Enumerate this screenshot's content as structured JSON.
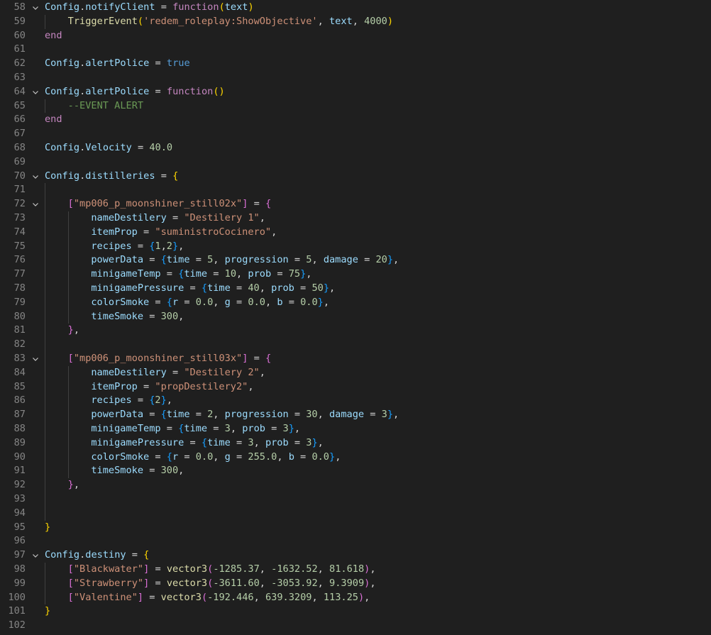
{
  "colors": {
    "background": "#1f1f1f",
    "line_number": "#858585",
    "default": "#d4d4d4",
    "variable": "#9cdcfe",
    "keyword": "#c586c0",
    "function": "#dcdcaa",
    "string": "#ce9178",
    "number": "#b5cea8",
    "constant": "#569cd6",
    "comment": "#6a9955",
    "bracket1": "#ffd700",
    "bracket2": "#da70d6",
    "bracket3": "#179fff"
  },
  "lines": [
    {
      "n": "58",
      "fold": true,
      "indent": 0,
      "tokens": [
        [
          "Config",
          "v"
        ],
        [
          ".",
          "d"
        ],
        [
          "notifyClient",
          "v"
        ],
        [
          " = ",
          "d"
        ],
        [
          "function",
          "k"
        ],
        [
          "(",
          "b1"
        ],
        [
          "text",
          "v"
        ],
        [
          ")",
          "b1"
        ]
      ]
    },
    {
      "n": "59",
      "fold": false,
      "indent": 1,
      "tokens": [
        [
          "TriggerEvent",
          "f"
        ],
        [
          "(",
          "b1"
        ],
        [
          "'redem_roleplay:ShowObjective'",
          "s"
        ],
        [
          ", ",
          "d"
        ],
        [
          "text",
          "v"
        ],
        [
          ", ",
          "d"
        ],
        [
          "4000",
          "n"
        ],
        [
          ")",
          "b1"
        ]
      ]
    },
    {
      "n": "60",
      "fold": false,
      "indent": 0,
      "tokens": [
        [
          "end",
          "k"
        ]
      ]
    },
    {
      "n": "61",
      "fold": false,
      "indent": 0,
      "tokens": []
    },
    {
      "n": "62",
      "fold": false,
      "indent": 0,
      "tokens": [
        [
          "Config",
          "v"
        ],
        [
          ".",
          "d"
        ],
        [
          "alertPolice",
          "v"
        ],
        [
          " = ",
          "d"
        ],
        [
          "true",
          "c"
        ]
      ]
    },
    {
      "n": "63",
      "fold": false,
      "indent": 0,
      "tokens": []
    },
    {
      "n": "64",
      "fold": true,
      "indent": 0,
      "tokens": [
        [
          "Config",
          "v"
        ],
        [
          ".",
          "d"
        ],
        [
          "alertPolice",
          "v"
        ],
        [
          " = ",
          "d"
        ],
        [
          "function",
          "k"
        ],
        [
          "()",
          "b1"
        ]
      ]
    },
    {
      "n": "65",
      "fold": false,
      "indent": 1,
      "tokens": [
        [
          "--EVENT ALERT",
          "cm"
        ]
      ]
    },
    {
      "n": "66",
      "fold": false,
      "indent": 0,
      "tokens": [
        [
          "end",
          "k"
        ]
      ]
    },
    {
      "n": "67",
      "fold": false,
      "indent": 0,
      "tokens": []
    },
    {
      "n": "68",
      "fold": false,
      "indent": 0,
      "tokens": [
        [
          "Config",
          "v"
        ],
        [
          ".",
          "d"
        ],
        [
          "Velocity",
          "v"
        ],
        [
          " = ",
          "d"
        ],
        [
          "40.0",
          "n"
        ]
      ]
    },
    {
      "n": "69",
      "fold": false,
      "indent": 0,
      "tokens": []
    },
    {
      "n": "70",
      "fold": true,
      "indent": 0,
      "tokens": [
        [
          "Config",
          "v"
        ],
        [
          ".",
          "d"
        ],
        [
          "distilleries",
          "v"
        ],
        [
          " = ",
          "d"
        ],
        [
          "{",
          "b1"
        ]
      ]
    },
    {
      "n": "71",
      "fold": false,
      "indent": 0,
      "tokens": []
    },
    {
      "n": "72",
      "fold": true,
      "indent": 1,
      "tokens": [
        [
          "[",
          "b2"
        ],
        [
          "\"mp006_p_moonshiner_still02x\"",
          "s"
        ],
        [
          "]",
          "b2"
        ],
        [
          " = ",
          "d"
        ],
        [
          "{",
          "b2"
        ]
      ]
    },
    {
      "n": "73",
      "fold": false,
      "indent": 2,
      "tokens": [
        [
          "nameDestilery",
          "v"
        ],
        [
          " = ",
          "d"
        ],
        [
          "\"Destilery 1\"",
          "s"
        ],
        [
          ",",
          "d"
        ]
      ]
    },
    {
      "n": "74",
      "fold": false,
      "indent": 2,
      "tokens": [
        [
          "itemProp",
          "v"
        ],
        [
          " = ",
          "d"
        ],
        [
          "\"suministroCocinero\"",
          "s"
        ],
        [
          ",",
          "d"
        ]
      ]
    },
    {
      "n": "75",
      "fold": false,
      "indent": 2,
      "tokens": [
        [
          "recipes",
          "v"
        ],
        [
          " = ",
          "d"
        ],
        [
          "{",
          "b3"
        ],
        [
          "1",
          "n"
        ],
        [
          ",",
          "d"
        ],
        [
          "2",
          "n"
        ],
        [
          "}",
          "b3"
        ],
        [
          ",",
          "d"
        ]
      ]
    },
    {
      "n": "76",
      "fold": false,
      "indent": 2,
      "tokens": [
        [
          "powerData",
          "v"
        ],
        [
          " = ",
          "d"
        ],
        [
          "{",
          "b3"
        ],
        [
          "time",
          "v"
        ],
        [
          " = ",
          "d"
        ],
        [
          "5",
          "n"
        ],
        [
          ", ",
          "d"
        ],
        [
          "progression",
          "v"
        ],
        [
          " = ",
          "d"
        ],
        [
          "5",
          "n"
        ],
        [
          ", ",
          "d"
        ],
        [
          "damage",
          "v"
        ],
        [
          " = ",
          "d"
        ],
        [
          "20",
          "n"
        ],
        [
          "}",
          "b3"
        ],
        [
          ",",
          "d"
        ]
      ]
    },
    {
      "n": "77",
      "fold": false,
      "indent": 2,
      "tokens": [
        [
          "minigameTemp",
          "v"
        ],
        [
          " = ",
          "d"
        ],
        [
          "{",
          "b3"
        ],
        [
          "time",
          "v"
        ],
        [
          " = ",
          "d"
        ],
        [
          "10",
          "n"
        ],
        [
          ", ",
          "d"
        ],
        [
          "prob",
          "v"
        ],
        [
          " = ",
          "d"
        ],
        [
          "75",
          "n"
        ],
        [
          "}",
          "b3"
        ],
        [
          ",",
          "d"
        ]
      ]
    },
    {
      "n": "78",
      "fold": false,
      "indent": 2,
      "tokens": [
        [
          "minigamePressure",
          "v"
        ],
        [
          " = ",
          "d"
        ],
        [
          "{",
          "b3"
        ],
        [
          "time",
          "v"
        ],
        [
          " = ",
          "d"
        ],
        [
          "40",
          "n"
        ],
        [
          ", ",
          "d"
        ],
        [
          "prob",
          "v"
        ],
        [
          " = ",
          "d"
        ],
        [
          "50",
          "n"
        ],
        [
          "}",
          "b3"
        ],
        [
          ",",
          "d"
        ]
      ]
    },
    {
      "n": "79",
      "fold": false,
      "indent": 2,
      "tokens": [
        [
          "colorSmoke",
          "v"
        ],
        [
          " = ",
          "d"
        ],
        [
          "{",
          "b3"
        ],
        [
          "r",
          "v"
        ],
        [
          " = ",
          "d"
        ],
        [
          "0.0",
          "n"
        ],
        [
          ", ",
          "d"
        ],
        [
          "g",
          "v"
        ],
        [
          " = ",
          "d"
        ],
        [
          "0.0",
          "n"
        ],
        [
          ", ",
          "d"
        ],
        [
          "b",
          "v"
        ],
        [
          " = ",
          "d"
        ],
        [
          "0.0",
          "n"
        ],
        [
          "}",
          "b3"
        ],
        [
          ",",
          "d"
        ]
      ]
    },
    {
      "n": "80",
      "fold": false,
      "indent": 2,
      "tokens": [
        [
          "timeSmoke",
          "v"
        ],
        [
          " = ",
          "d"
        ],
        [
          "300",
          "n"
        ],
        [
          ",",
          "d"
        ]
      ]
    },
    {
      "n": "81",
      "fold": false,
      "indent": 1,
      "tokens": [
        [
          "}",
          "b2"
        ],
        [
          ",",
          "d"
        ]
      ]
    },
    {
      "n": "82",
      "fold": false,
      "indent": 0,
      "tokens": []
    },
    {
      "n": "83",
      "fold": true,
      "indent": 1,
      "tokens": [
        [
          "[",
          "b2"
        ],
        [
          "\"mp006_p_moonshiner_still03x\"",
          "s"
        ],
        [
          "]",
          "b2"
        ],
        [
          " = ",
          "d"
        ],
        [
          "{",
          "b2"
        ]
      ]
    },
    {
      "n": "84",
      "fold": false,
      "indent": 2,
      "tokens": [
        [
          "nameDestilery",
          "v"
        ],
        [
          " = ",
          "d"
        ],
        [
          "\"Destilery 2\"",
          "s"
        ],
        [
          ",",
          "d"
        ]
      ]
    },
    {
      "n": "85",
      "fold": false,
      "indent": 2,
      "tokens": [
        [
          "itemProp",
          "v"
        ],
        [
          " = ",
          "d"
        ],
        [
          "\"propDestilery2\"",
          "s"
        ],
        [
          ",",
          "d"
        ]
      ]
    },
    {
      "n": "86",
      "fold": false,
      "indent": 2,
      "tokens": [
        [
          "recipes",
          "v"
        ],
        [
          " = ",
          "d"
        ],
        [
          "{",
          "b3"
        ],
        [
          "2",
          "n"
        ],
        [
          "}",
          "b3"
        ],
        [
          ",",
          "d"
        ]
      ]
    },
    {
      "n": "87",
      "fold": false,
      "indent": 2,
      "tokens": [
        [
          "powerData",
          "v"
        ],
        [
          " = ",
          "d"
        ],
        [
          "{",
          "b3"
        ],
        [
          "time",
          "v"
        ],
        [
          " = ",
          "d"
        ],
        [
          "2",
          "n"
        ],
        [
          ", ",
          "d"
        ],
        [
          "progression",
          "v"
        ],
        [
          " = ",
          "d"
        ],
        [
          "30",
          "n"
        ],
        [
          ", ",
          "d"
        ],
        [
          "damage",
          "v"
        ],
        [
          " = ",
          "d"
        ],
        [
          "3",
          "n"
        ],
        [
          "}",
          "b3"
        ],
        [
          ",",
          "d"
        ]
      ]
    },
    {
      "n": "88",
      "fold": false,
      "indent": 2,
      "tokens": [
        [
          "minigameTemp",
          "v"
        ],
        [
          " = ",
          "d"
        ],
        [
          "{",
          "b3"
        ],
        [
          "time",
          "v"
        ],
        [
          " = ",
          "d"
        ],
        [
          "3",
          "n"
        ],
        [
          ", ",
          "d"
        ],
        [
          "prob",
          "v"
        ],
        [
          " = ",
          "d"
        ],
        [
          "3",
          "n"
        ],
        [
          "}",
          "b3"
        ],
        [
          ",",
          "d"
        ]
      ]
    },
    {
      "n": "89",
      "fold": false,
      "indent": 2,
      "tokens": [
        [
          "minigamePressure",
          "v"
        ],
        [
          " = ",
          "d"
        ],
        [
          "{",
          "b3"
        ],
        [
          "time",
          "v"
        ],
        [
          " = ",
          "d"
        ],
        [
          "3",
          "n"
        ],
        [
          ", ",
          "d"
        ],
        [
          "prob",
          "v"
        ],
        [
          " = ",
          "d"
        ],
        [
          "3",
          "n"
        ],
        [
          "}",
          "b3"
        ],
        [
          ",",
          "d"
        ]
      ]
    },
    {
      "n": "90",
      "fold": false,
      "indent": 2,
      "tokens": [
        [
          "colorSmoke",
          "v"
        ],
        [
          " = ",
          "d"
        ],
        [
          "{",
          "b3"
        ],
        [
          "r",
          "v"
        ],
        [
          " = ",
          "d"
        ],
        [
          "0.0",
          "n"
        ],
        [
          ", ",
          "d"
        ],
        [
          "g",
          "v"
        ],
        [
          " = ",
          "d"
        ],
        [
          "255.0",
          "n"
        ],
        [
          ", ",
          "d"
        ],
        [
          "b",
          "v"
        ],
        [
          " = ",
          "d"
        ],
        [
          "0.0",
          "n"
        ],
        [
          "}",
          "b3"
        ],
        [
          ",",
          "d"
        ]
      ]
    },
    {
      "n": "91",
      "fold": false,
      "indent": 2,
      "tokens": [
        [
          "timeSmoke",
          "v"
        ],
        [
          " = ",
          "d"
        ],
        [
          "300",
          "n"
        ],
        [
          ",",
          "d"
        ]
      ]
    },
    {
      "n": "92",
      "fold": false,
      "indent": 1,
      "tokens": [
        [
          "}",
          "b2"
        ],
        [
          ",",
          "d"
        ]
      ]
    },
    {
      "n": "93",
      "fold": false,
      "indent": 0,
      "tokens": []
    },
    {
      "n": "94",
      "fold": false,
      "indent": 0,
      "tokens": []
    },
    {
      "n": "95",
      "fold": false,
      "indent": 0,
      "tokens": [
        [
          "}",
          "b1"
        ]
      ]
    },
    {
      "n": "96",
      "fold": false,
      "indent": 0,
      "tokens": []
    },
    {
      "n": "97",
      "fold": true,
      "indent": 0,
      "tokens": [
        [
          "Config",
          "v"
        ],
        [
          ".",
          "d"
        ],
        [
          "destiny",
          "v"
        ],
        [
          " = ",
          "d"
        ],
        [
          "{",
          "b1"
        ]
      ]
    },
    {
      "n": "98",
      "fold": false,
      "indent": 1,
      "tokens": [
        [
          "[",
          "b2"
        ],
        [
          "\"Blackwater\"",
          "s"
        ],
        [
          "]",
          "b2"
        ],
        [
          " = ",
          "d"
        ],
        [
          "vector3",
          "f"
        ],
        [
          "(",
          "b2"
        ],
        [
          "-1285.37",
          "n"
        ],
        [
          ", ",
          "d"
        ],
        [
          "-1632.52",
          "n"
        ],
        [
          ", ",
          "d"
        ],
        [
          "81.618",
          "n"
        ],
        [
          ")",
          "b2"
        ],
        [
          ",",
          "d"
        ]
      ]
    },
    {
      "n": "99",
      "fold": false,
      "indent": 1,
      "tokens": [
        [
          "[",
          "b2"
        ],
        [
          "\"Strawberry\"",
          "s"
        ],
        [
          "]",
          "b2"
        ],
        [
          " = ",
          "d"
        ],
        [
          "vector3",
          "f"
        ],
        [
          "(",
          "b2"
        ],
        [
          "-3611.60",
          "n"
        ],
        [
          ", ",
          "d"
        ],
        [
          "-3053.92",
          "n"
        ],
        [
          ", ",
          "d"
        ],
        [
          "9.3909",
          "n"
        ],
        [
          ")",
          "b2"
        ],
        [
          ",",
          "d"
        ]
      ]
    },
    {
      "n": "100",
      "fold": false,
      "indent": 1,
      "tokens": [
        [
          "[",
          "b2"
        ],
        [
          "\"Valentine\"",
          "s"
        ],
        [
          "]",
          "b2"
        ],
        [
          " = ",
          "d"
        ],
        [
          "vector3",
          "f"
        ],
        [
          "(",
          "b2"
        ],
        [
          "-192.446",
          "n"
        ],
        [
          ", ",
          "d"
        ],
        [
          "639.3209",
          "n"
        ],
        [
          ", ",
          "d"
        ],
        [
          "113.25",
          "n"
        ],
        [
          ")",
          "b2"
        ],
        [
          ",",
          "d"
        ]
      ]
    },
    {
      "n": "101",
      "fold": false,
      "indent": 0,
      "tokens": [
        [
          "}",
          "b1"
        ]
      ]
    },
    {
      "n": "102",
      "fold": false,
      "indent": 0,
      "tokens": []
    }
  ]
}
